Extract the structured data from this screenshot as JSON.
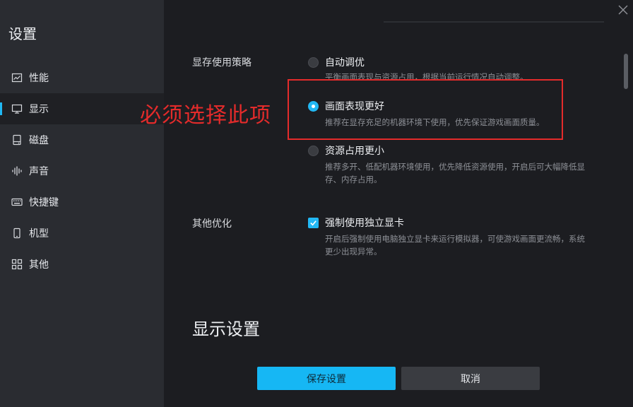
{
  "sidebar": {
    "title": "设置",
    "items": [
      {
        "label": "性能",
        "icon": "chart-icon"
      },
      {
        "label": "显示",
        "icon": "monitor-icon",
        "active": true
      },
      {
        "label": "磁盘",
        "icon": "disk-icon"
      },
      {
        "label": "声音",
        "icon": "sound-wave-icon"
      },
      {
        "label": "快捷键",
        "icon": "keyboard-icon"
      },
      {
        "label": "机型",
        "icon": "phone-icon"
      },
      {
        "label": "其他",
        "icon": "grid-icon"
      }
    ]
  },
  "memory_strategy": {
    "label": "显存使用策略",
    "options": [
      {
        "label": "自动调优",
        "desc": "平衡画面表现与资源占用，根据当前运行情况自动调整。",
        "checked": false
      },
      {
        "label": "画面表现更好",
        "desc": "推荐在显存充足的机器环境下使用，优先保证游戏画面质量。",
        "checked": true
      },
      {
        "label": "资源占用更小",
        "desc1": "推荐多开、低配机器环境使用，优先降低资源使用，开启后可大幅降低显",
        "desc2": "存、内存占用。",
        "checked": false
      }
    ]
  },
  "other_optimization": {
    "label": "其他优化",
    "checkbox_label": "强制使用独立显卡",
    "desc1": "开启后强制使用电脑独立显卡来运行模拟器，可使游戏画面更流畅，系统",
    "desc2": "更少出现异常。",
    "checked": true
  },
  "annotation": "必须选择此项",
  "display_heading": "显示设置",
  "buttons": {
    "save": "保存设置",
    "cancel": "取消"
  },
  "colors": {
    "accent": "#16b7f4",
    "annotation": "#e42b2b",
    "sidebar_bg": "#2a2c31",
    "main_bg": "#1c1d21"
  }
}
